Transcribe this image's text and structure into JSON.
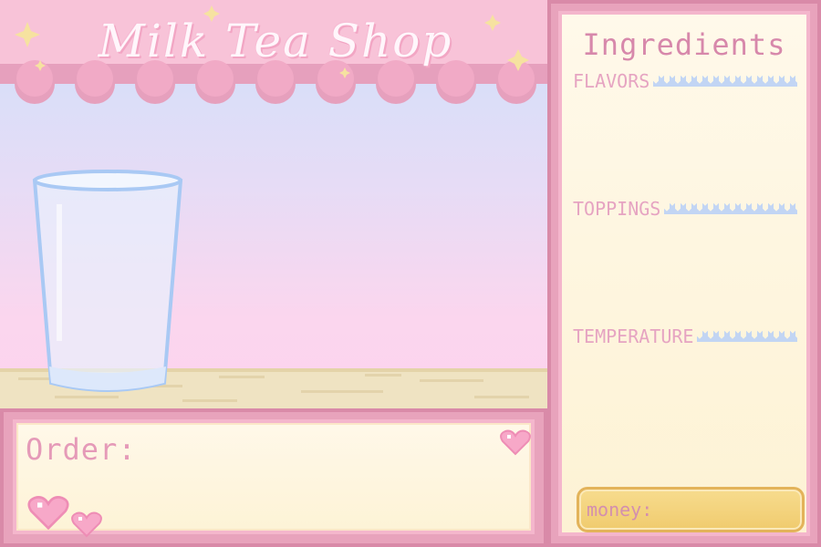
{
  "shop": {
    "title": "Milk Tea Shop"
  },
  "order": {
    "label": "Order:"
  },
  "ingredients": {
    "title": "Ingredients",
    "sections": [
      {
        "label": "Flavors"
      },
      {
        "label": "Toppings"
      },
      {
        "label": "Temperature"
      }
    ]
  },
  "money": {
    "label": "money:"
  },
  "colors": {
    "pink": "#f6c9dd",
    "pink_border": "#d98aa8",
    "cream": "#fdf3d6",
    "sky_blue": "#cfe0fb",
    "gold": "#f0cb6e"
  }
}
